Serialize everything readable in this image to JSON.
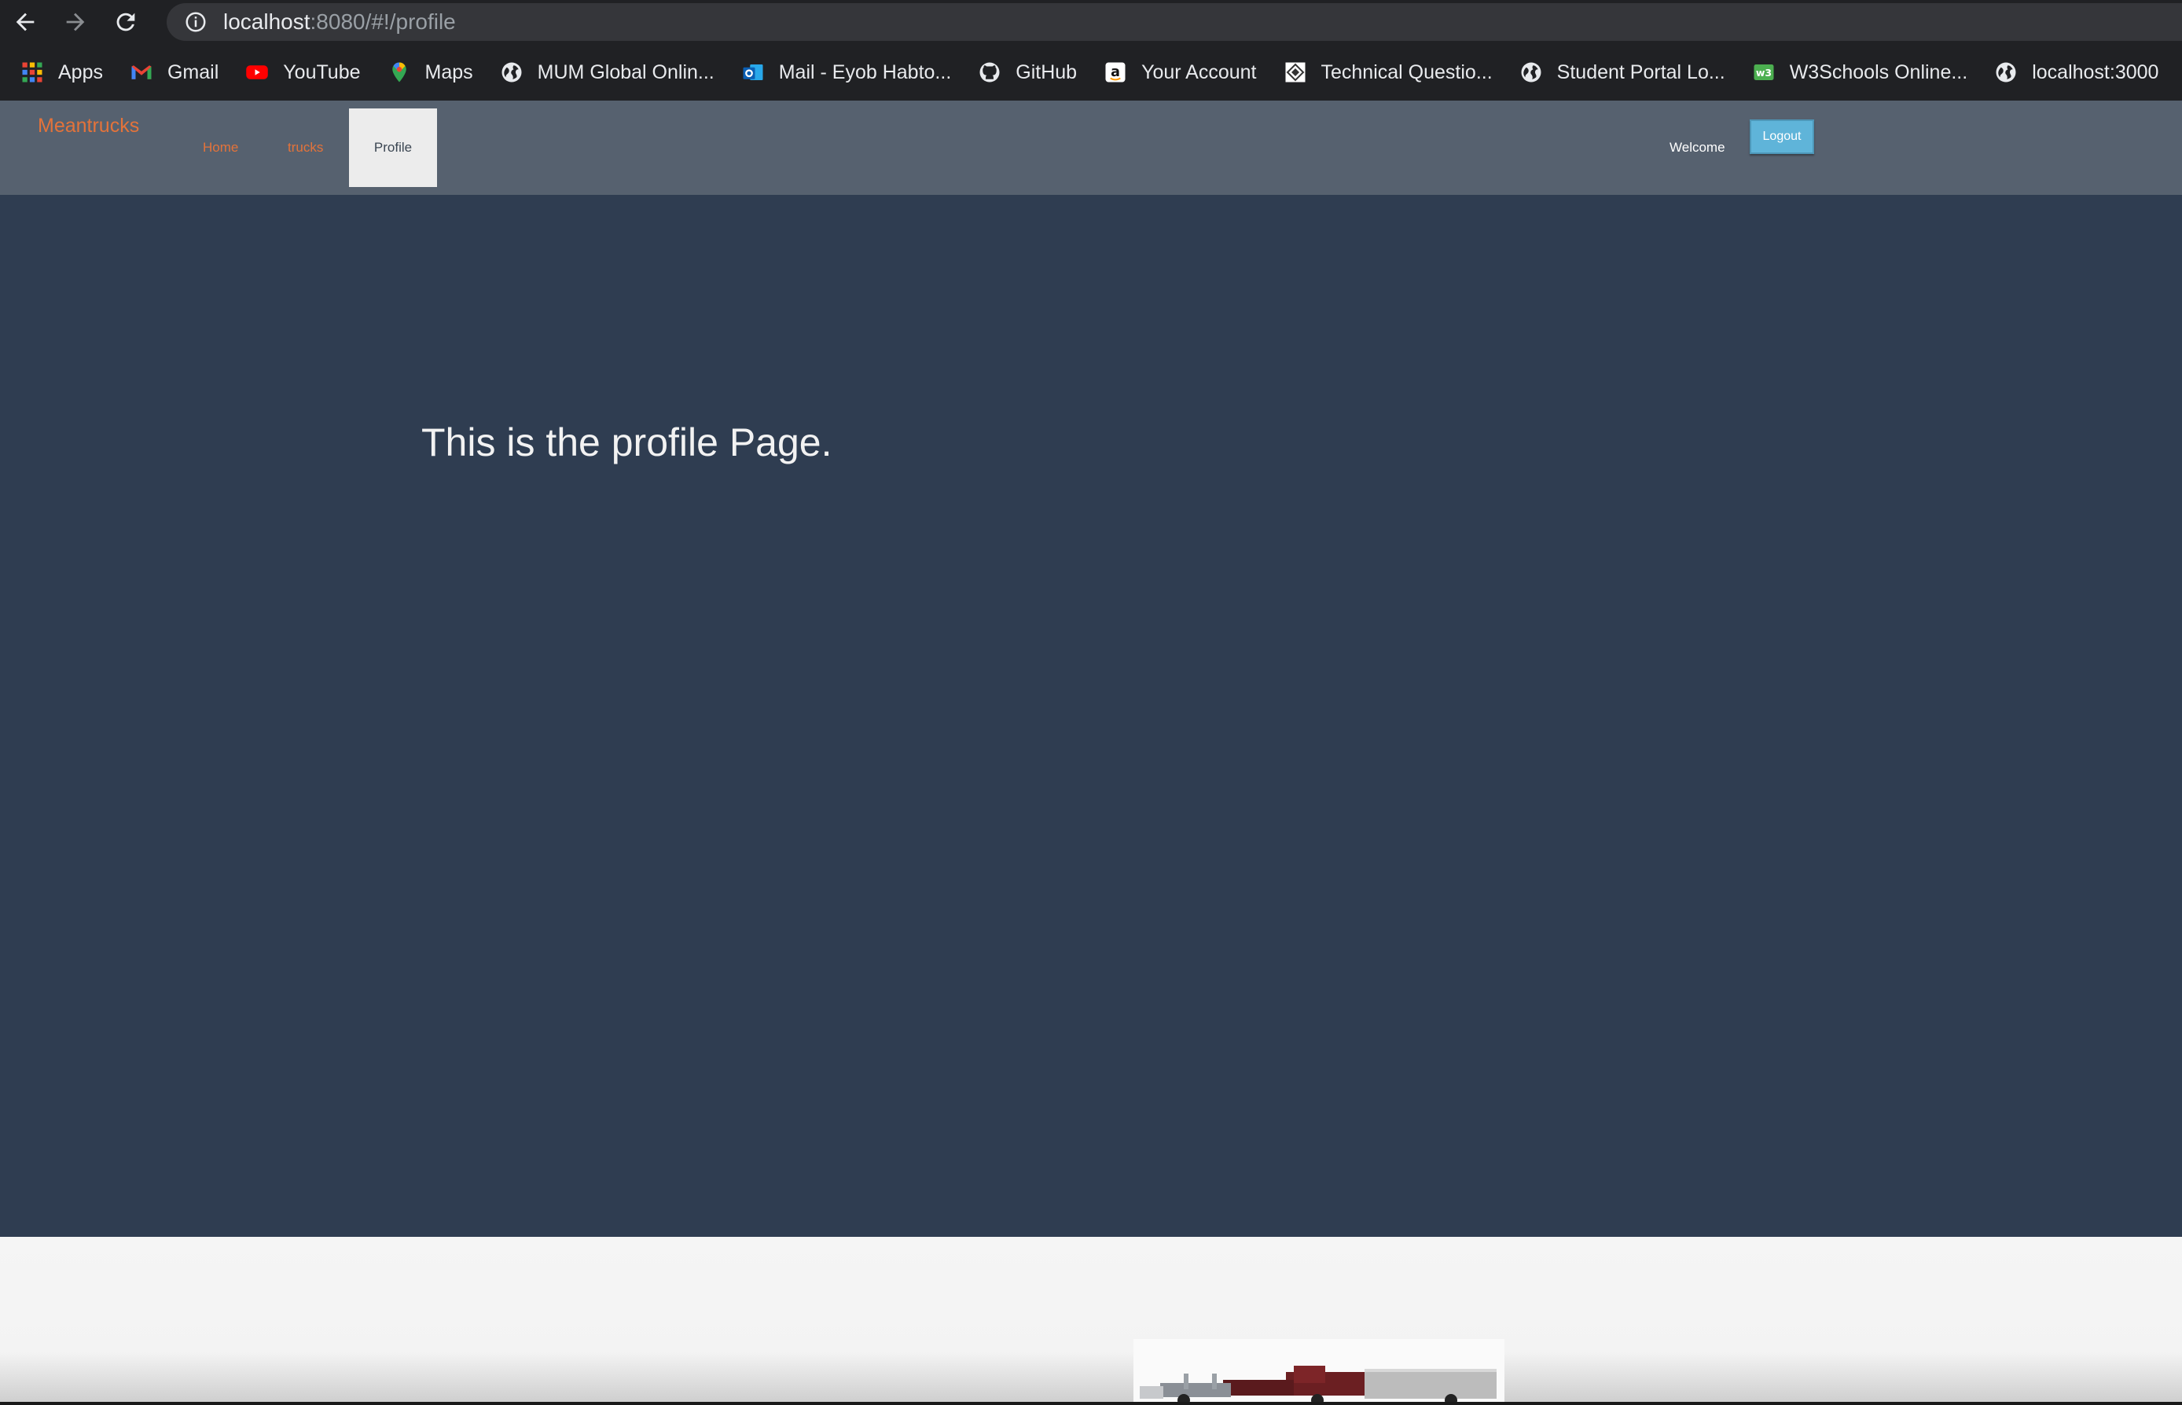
{
  "browser": {
    "url_host": "localhost",
    "url_rest": ":8080/#!/profile",
    "bookmarks": [
      {
        "label": "Apps",
        "icon": "apps-grid-icon"
      },
      {
        "label": "Gmail",
        "icon": "gmail-icon"
      },
      {
        "label": "YouTube",
        "icon": "youtube-icon"
      },
      {
        "label": "Maps",
        "icon": "maps-pin-icon"
      },
      {
        "label": "MUM Global Onlin...",
        "icon": "globe-icon"
      },
      {
        "label": "Mail - Eyob Habto...",
        "icon": "outlook-icon"
      },
      {
        "label": "GitHub",
        "icon": "github-icon"
      },
      {
        "label": "Your Account",
        "icon": "amazon-icon"
      },
      {
        "label": "Technical Questio...",
        "icon": "diamond-logo-icon"
      },
      {
        "label": "Student Portal Lo...",
        "icon": "globe-icon"
      },
      {
        "label": "W3Schools Online...",
        "icon": "w3schools-icon"
      },
      {
        "label": "localhost:3000",
        "icon": "globe-icon"
      }
    ]
  },
  "app": {
    "brand": "Meantrucks",
    "nav": {
      "home": "Home",
      "trucks": "trucks",
      "profile": "Profile"
    },
    "welcome": "Welcome",
    "logout": "Logout",
    "page_title": "This is the profile Page."
  },
  "colors": {
    "nav_bg": "#56616f",
    "content_bg": "#2f3d51",
    "brand_accent": "#e4733a",
    "logout_bg": "#5fb4d9"
  }
}
